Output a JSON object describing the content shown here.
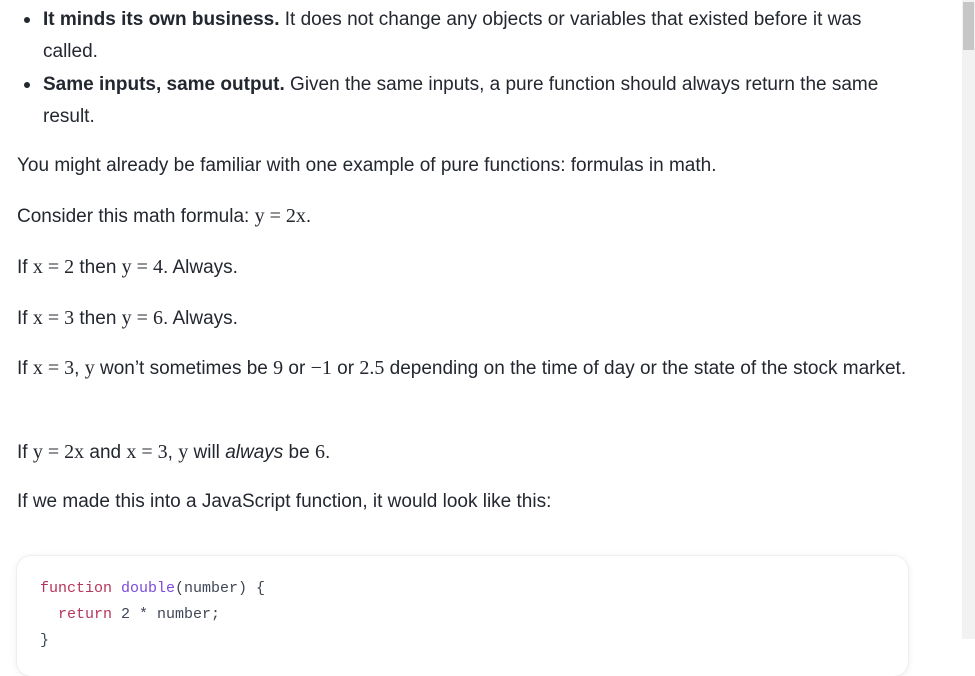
{
  "bullets": [
    {
      "bold": "It minds its own business.",
      "text": " It does not change any objects or variables that existed before it was called."
    },
    {
      "bold": "Same inputs, same output.",
      "text": " Given the same inputs, a pure function should always return the same result."
    }
  ],
  "p1": "You might already be familiar with one example of pure functions: formulas in math.",
  "p2": {
    "prefix": "Consider this math formula: ",
    "formula": "y = 2x",
    "suffix": "."
  },
  "p3": {
    "a": "If ",
    "m1": "x = 2",
    "b": " then ",
    "m2": "y = 4",
    "c": ". Always."
  },
  "p4": {
    "a": "If ",
    "m1": "x = 3",
    "b": " then ",
    "m2": "y = 6",
    "c": ". Always."
  },
  "p5": {
    "a": "If ",
    "m1": "x = 3",
    "b": ", ",
    "m2": "y",
    "c": " won’t sometimes be ",
    "m3": "9",
    "d": " or ",
    "m4": "−1",
    "e": " or ",
    "m5": "2.5",
    "f": " depending on the time of day or the state of the stock market."
  },
  "p6": {
    "a": "If ",
    "m1": "y = 2x",
    "b": " and ",
    "m2": "x = 3",
    "c": ", ",
    "m3": "y",
    "d": " will ",
    "em": "always",
    "e": " be ",
    "m4": "6",
    "f": "."
  },
  "p7": "If we made this into a JavaScript function, it would look like this:",
  "code": {
    "line1_kw": "function",
    "line1_fn": "double",
    "line1_rest": "(number) {",
    "line2_kw": "return",
    "line2_rest": " 2 * number;",
    "line3": "}"
  }
}
